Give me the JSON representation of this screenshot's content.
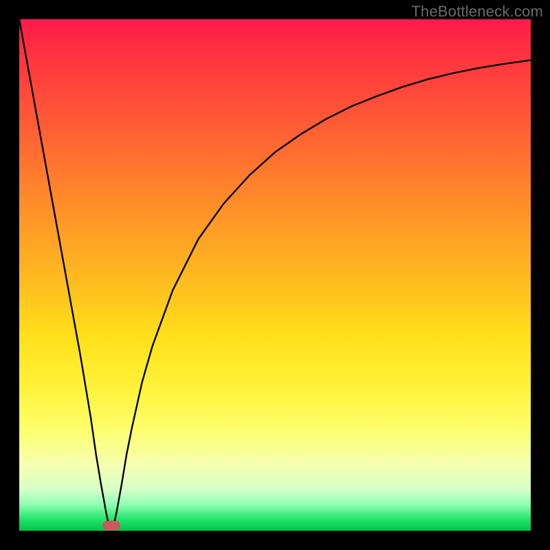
{
  "watermark": {
    "text": "TheBottleneck.com"
  },
  "colors": {
    "background": "#000000",
    "gradient_top": "#ff1a4b",
    "gradient_bottom": "#00c44a",
    "curve": "#000000",
    "marker": "#c85a5a"
  },
  "chart_data": {
    "type": "line",
    "title": "",
    "xlabel": "",
    "ylabel": "",
    "xlim": [
      0,
      100
    ],
    "ylim": [
      0,
      100
    ],
    "grid": false,
    "legend": false,
    "annotations": [],
    "description": "Bottleneck percentage curve. The y-axis represents bottleneck percentage (0% at the bottom green band, ~100% at the top red band). The x-axis represents a hardware balance parameter. The curve dips to ~0% near x≈18 (the optimal balance point) and rises steeply elsewhere. A short thick salmon marker sits at the minimum.",
    "series": [
      {
        "name": "bottleneck",
        "x": [
          0,
          2,
          4,
          6,
          8,
          10,
          12,
          14,
          15,
          16,
          17,
          17.5,
          18,
          18.5,
          19,
          20,
          21,
          22,
          24,
          26,
          30,
          35,
          40,
          45,
          50,
          55,
          60,
          65,
          70,
          75,
          80,
          85,
          90,
          95,
          100
        ],
        "y": [
          100,
          89,
          78,
          67,
          56,
          45,
          34,
          22,
          15,
          9,
          3.5,
          1.2,
          1.0,
          1.2,
          3.5,
          9,
          15,
          20,
          29,
          36,
          47,
          57,
          64,
          69.5,
          74,
          77.5,
          80.5,
          83,
          85,
          86.8,
          88.3,
          89.5,
          90.5,
          91.3,
          92
        ]
      }
    ],
    "optimal_marker": {
      "x_start": 17.2,
      "x_end": 18.8,
      "y": 1.0
    }
  }
}
